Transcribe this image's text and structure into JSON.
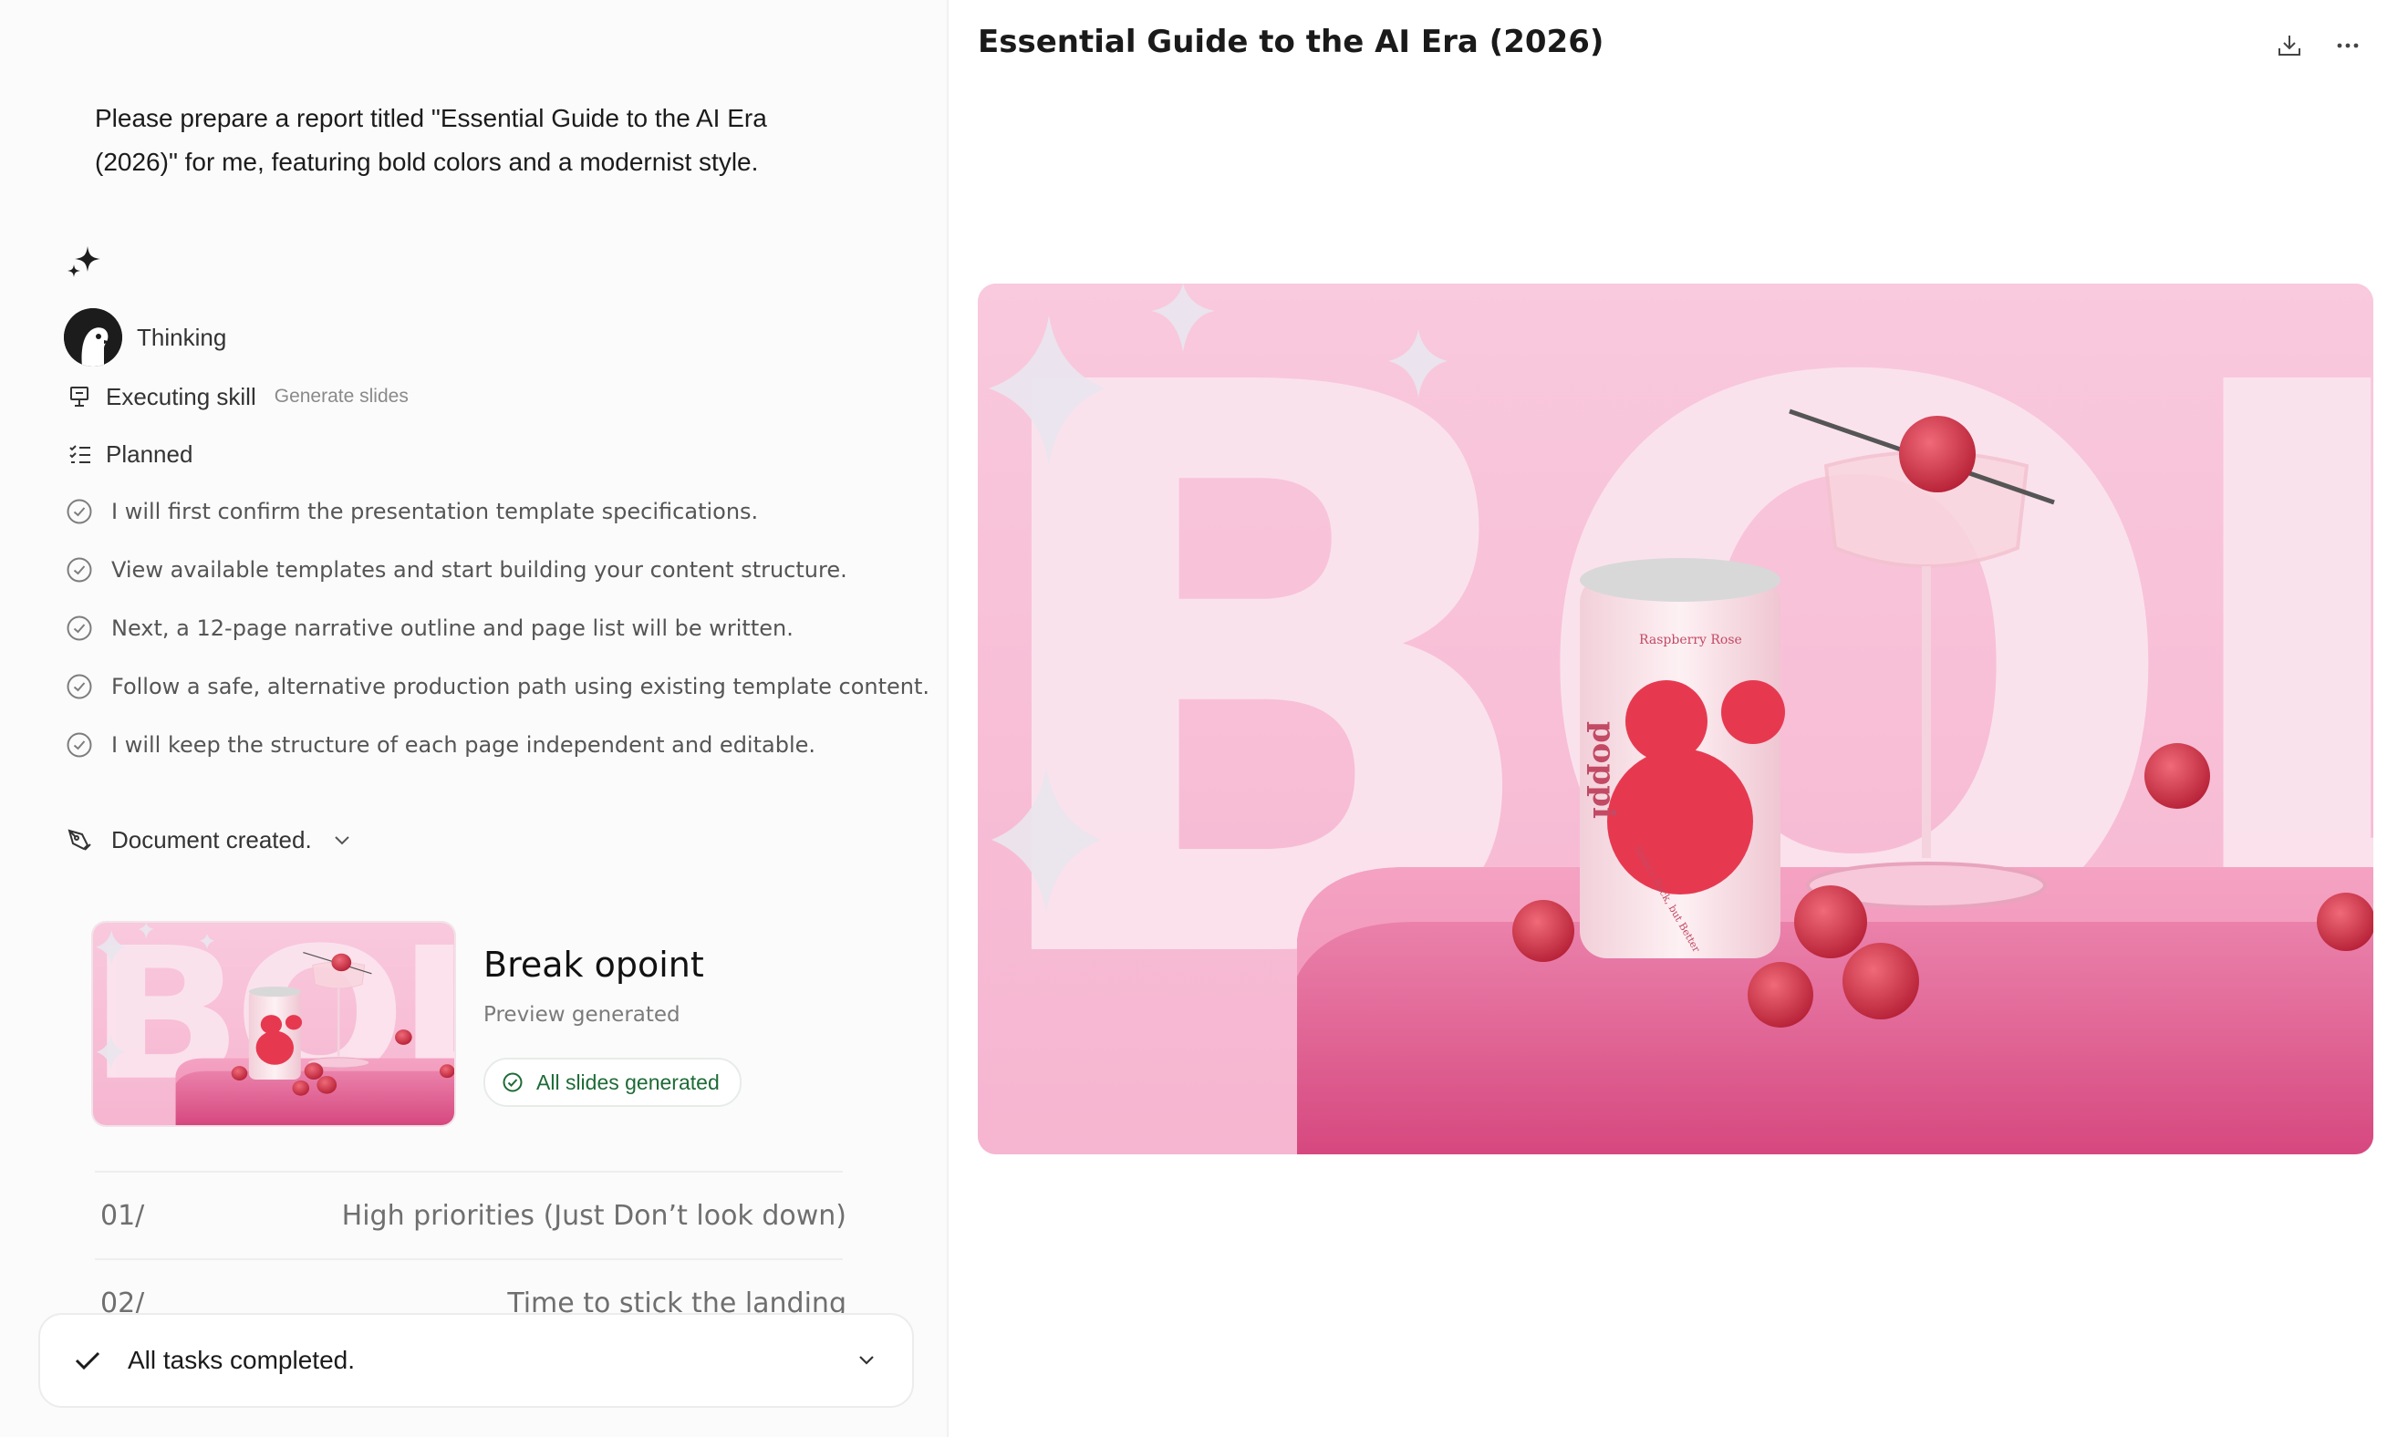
{
  "chat": {
    "prompt": "Please prepare a report titled \"Essential Guide to the AI Era (2026)\" for me, featuring bold colors and a modernist style.",
    "thinking_label": "Thinking",
    "executing_label": "Executing skill",
    "executing_detail": "Generate slides",
    "planned_label": "Planned",
    "plan_items": [
      "I will first confirm the presentation template specifications.",
      "View available templates and start building your content structure.",
      "Next, a 12-page narrative outline and page list will be written.",
      "Follow a safe, alternative production path using existing template content.",
      "I will keep the structure of each page independent and editable."
    ],
    "document_label": "Document created.",
    "card": {
      "title": "Break opoint",
      "subtitle": "Preview generated",
      "badge": "All slides generated"
    },
    "outline": [
      {
        "num": "01/",
        "title": "High priorities (Just Don’t look down)"
      },
      {
        "num": "02/",
        "title": "Time to stick the landing"
      }
    ],
    "status": "All tasks completed."
  },
  "viewer": {
    "title": "Essential Guide to the AI Era (2026)"
  },
  "slide": {
    "word": "BOLD",
    "can_brand": "poppi",
    "can_flavor": "Raspberry Rose",
    "can_tagline": "Soda's Back, but Better"
  },
  "colors": {
    "accent_pink": "#f4a3c4",
    "deep_pink": "#d6487f",
    "success_green": "#1d6b36"
  },
  "icons": [
    "sparkle-icon",
    "avatar",
    "presentation-icon",
    "checklist-icon",
    "check-circle-icon",
    "pen-tool-icon",
    "chevron-down-icon",
    "checkmark-icon",
    "download-icon",
    "more-icon"
  ]
}
